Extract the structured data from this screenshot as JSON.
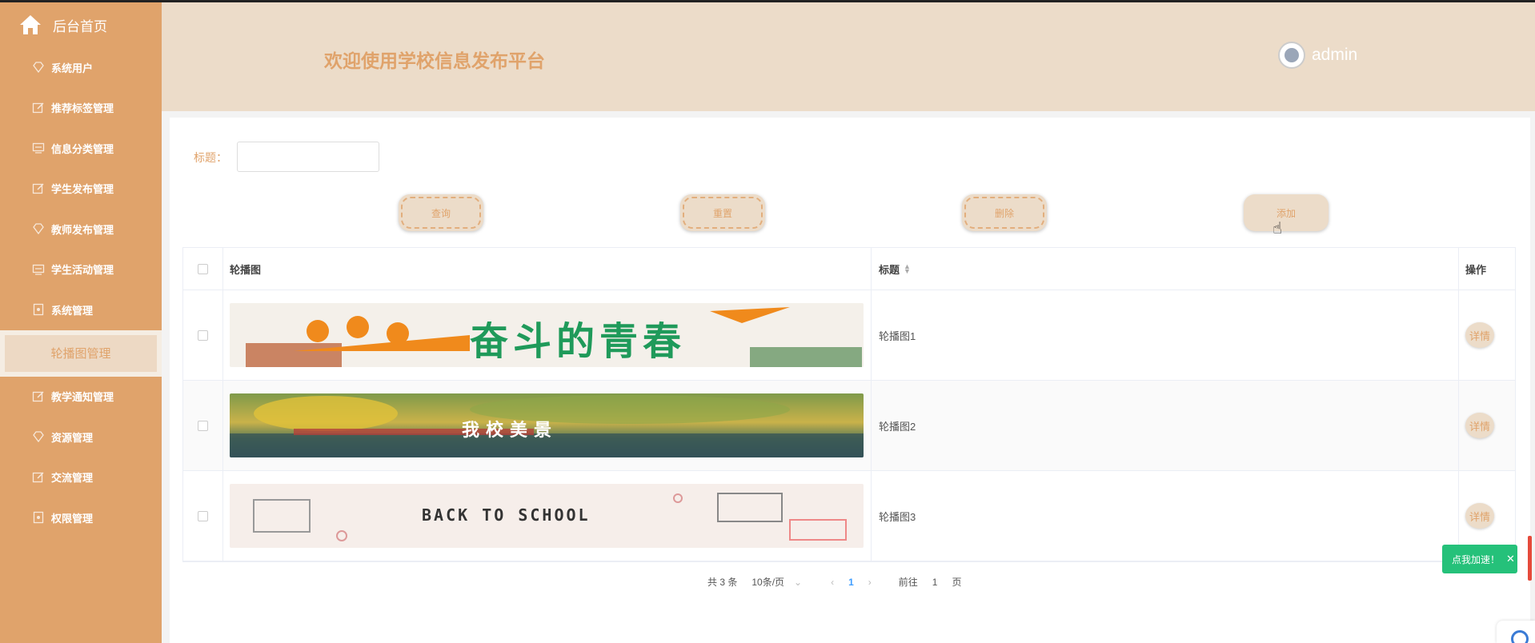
{
  "sidebar": {
    "home_label": "后台首页",
    "items": [
      {
        "label": "系统用户",
        "icon": "diamond-icon"
      },
      {
        "label": "推荐标签管理",
        "icon": "edit-icon"
      },
      {
        "label": "信息分类管理",
        "icon": "monitor-icon"
      },
      {
        "label": "学生发布管理",
        "icon": "edit-icon"
      },
      {
        "label": "教师发布管理",
        "icon": "diamond-icon"
      },
      {
        "label": "学生活动管理",
        "icon": "monitor-icon"
      },
      {
        "label": "系统管理",
        "icon": "doc-icon"
      },
      {
        "label": "轮播图管理",
        "icon": "",
        "active": true
      },
      {
        "label": "教学通知管理",
        "icon": "edit-icon"
      },
      {
        "label": "资源管理",
        "icon": "diamond-icon"
      },
      {
        "label": "交流管理",
        "icon": "edit-icon"
      },
      {
        "label": "权限管理",
        "icon": "doc-icon"
      }
    ]
  },
  "header": {
    "welcome": "欢迎使用学校信息发布平台",
    "username": "admin"
  },
  "search": {
    "label": "标题：",
    "value": ""
  },
  "buttons": {
    "query": "查询",
    "reset": "重置",
    "delete": "删除",
    "add": "添加"
  },
  "table": {
    "headers": {
      "image": "轮播图",
      "title": "标题",
      "action": "操作"
    },
    "rows": [
      {
        "title": "轮播图1",
        "action": "详情",
        "banner_text": "奋斗的青春"
      },
      {
        "title": "轮播图2",
        "action": "详情",
        "banner_text": "我校美景"
      },
      {
        "title": "轮播图3",
        "action": "详情",
        "banner_text": "BACK TO SCHOOL"
      }
    ]
  },
  "pagination": {
    "total": "共 3 条",
    "page_size": "10条/页",
    "current_page": "1",
    "goto_label": "前往",
    "goto_value": "1",
    "page_suffix": "页"
  },
  "floating": {
    "speedup_label": "点我加速！"
  },
  "colors": {
    "sidebar": "#e0a36b",
    "header": "#ecdcc9",
    "accent": "#e0a36b",
    "speedup": "#25c17a"
  }
}
